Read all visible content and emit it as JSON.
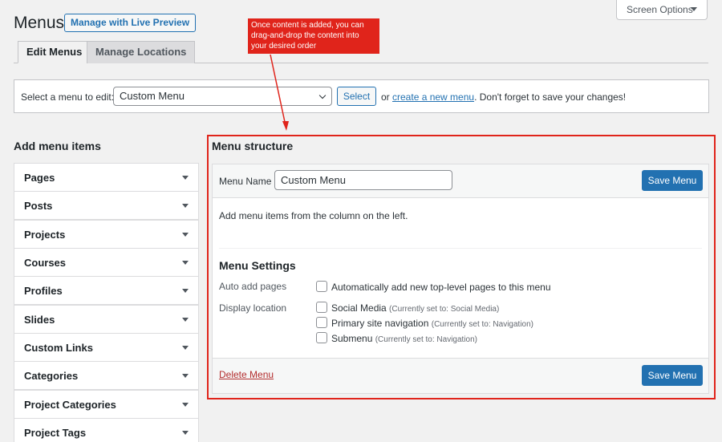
{
  "header": {
    "title": "Menus",
    "live_preview": "Manage with Live Preview",
    "screen_options": "Screen Options"
  },
  "tabs": [
    {
      "label": "Edit Menus"
    },
    {
      "label": "Manage Locations"
    }
  ],
  "select_bar": {
    "label": "Select a menu to edit:",
    "selected": "Custom Menu",
    "button": "Select",
    "or": "or",
    "create_link": "create a new menu",
    "reminder": ". Don't forget to save your changes!"
  },
  "add_items": {
    "title": "Add menu items",
    "items": [
      {
        "label": "Pages"
      },
      {
        "label": "Posts"
      },
      {
        "label": "Projects"
      },
      {
        "label": "Courses"
      },
      {
        "label": "Profiles"
      },
      {
        "label": "Slides"
      },
      {
        "label": "Custom Links"
      },
      {
        "label": "Categories"
      },
      {
        "label": "Project Categories"
      },
      {
        "label": "Project Tags"
      }
    ]
  },
  "structure": {
    "title": "Menu structure",
    "menu_name_label": "Menu Name",
    "menu_name_value": "Custom Menu",
    "save_label": "Save Menu",
    "hint": "Add menu items from the column on the left.",
    "settings_title": "Menu Settings",
    "auto_add_label": "Auto add pages",
    "auto_add_option": "Automatically add new top-level pages to this menu",
    "display_label": "Display location",
    "locations": [
      {
        "name": "Social Media",
        "note": "(Currently set to: Social Media)"
      },
      {
        "name": "Primary site navigation",
        "note": "(Currently set to: Navigation)"
      },
      {
        "name": "Submenu",
        "note": "(Currently set to: Navigation)"
      }
    ],
    "delete_label": "Delete Menu"
  },
  "annotation": {
    "text": "Once content is added, you can drag-and-drop the content into your desired order",
    "color": "#e0241b"
  },
  "colors": {
    "accent": "#2271b1",
    "danger": "#b32d2e"
  }
}
